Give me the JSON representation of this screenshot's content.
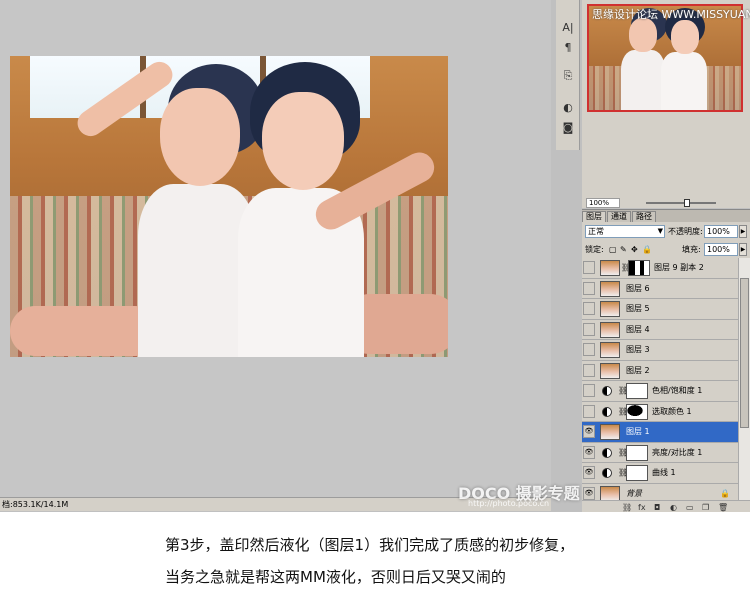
{
  "watermark_top": "思缘设计论坛 WWW.MISSYUAN.COM",
  "status": {
    "doc_size": "档:853.1K/14.1M"
  },
  "navigator": {
    "zoom": "100%"
  },
  "layers_panel": {
    "tabs": [
      "图层",
      "通道",
      "路径"
    ],
    "blend_mode": "正常",
    "opacity_label": "不透明度:",
    "opacity_value": "100%",
    "lock_label": "锁定:",
    "fill_label": "填充:",
    "fill_value": "100%",
    "layers": [
      {
        "name": "图层 9 副本 2",
        "type": "pixel-mask",
        "visible": false,
        "selected": false
      },
      {
        "name": "图层 6",
        "type": "pixel",
        "visible": false,
        "selected": false
      },
      {
        "name": "图层 5",
        "type": "pixel",
        "visible": false,
        "selected": false
      },
      {
        "name": "图层 4",
        "type": "pixel",
        "visible": false,
        "selected": false
      },
      {
        "name": "图层 3",
        "type": "pixel",
        "visible": false,
        "selected": false
      },
      {
        "name": "图层 2",
        "type": "pixel",
        "visible": false,
        "selected": false
      },
      {
        "name": "色相/饱和度 1",
        "type": "adjustment",
        "visible": false,
        "selected": false
      },
      {
        "name": "选取颜色 1",
        "type": "adjustment-dark",
        "visible": false,
        "selected": false
      },
      {
        "name": "图层 1",
        "type": "pixel",
        "visible": true,
        "selected": true
      },
      {
        "name": "亮度/对比度 1",
        "type": "adjustment",
        "visible": true,
        "selected": false
      },
      {
        "name": "曲线 1",
        "type": "adjustment",
        "visible": true,
        "selected": false
      },
      {
        "name": "背景",
        "type": "background",
        "visible": true,
        "selected": false
      }
    ]
  },
  "doco_watermark": "DOCO 摄影专题",
  "doco_url": "http://photo.poco.cn",
  "caption": {
    "line1": "第3步，盖印然后液化（图层1）我们完成了质感的初步修复，",
    "line2": "当务之急就是帮这两MM液化，否则日后又哭又闹的"
  },
  "colors": {
    "selection": "#3169c6",
    "panel": "#d4d0c8",
    "canvas_bg": "#c6c6c6",
    "nav_frame": "#d03030"
  }
}
